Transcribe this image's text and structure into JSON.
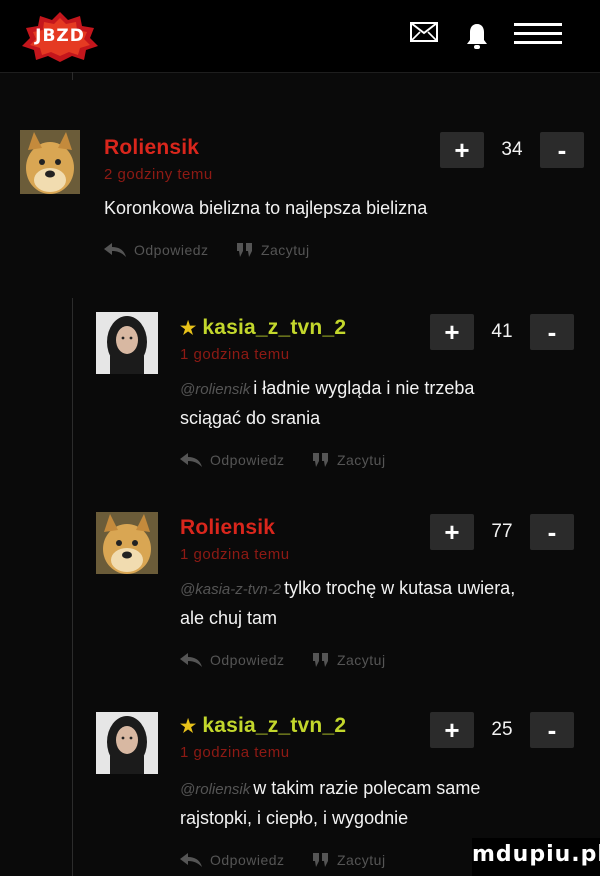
{
  "header": {
    "logo_text": "JBZD",
    "icons": [
      "mail-icon",
      "bell-icon",
      "menu-icon"
    ]
  },
  "actions": {
    "reply_label": "Odpowiedz",
    "quote_label": "Zacytuj"
  },
  "comments": [
    {
      "username": "Roliensik",
      "username_color": "#d9261c",
      "starred": false,
      "time": "2 godziny temu",
      "mention": "",
      "text_lines": [
        "Koronkowa bielizna to najlepsza bielizna"
      ],
      "score": "34",
      "avatar": "doge-avatar"
    },
    {
      "username": "kasia_z_tvn_2",
      "username_color": "#c3d72c",
      "starred": true,
      "time": "1 godzina temu",
      "mention": "@roliensik",
      "text_lines": [
        "i ładnie wygląda i nie trzeba",
        "sciągać do srania"
      ],
      "score": "41",
      "avatar": "woman-avatar"
    },
    {
      "username": "Roliensik",
      "username_color": "#d9261c",
      "starred": false,
      "time": "1 godzina temu",
      "mention": "@kasia-z-tvn-2",
      "text_lines": [
        "tylko trochę w kutasa uwiera,",
        "ale chuj tam"
      ],
      "score": "77",
      "avatar": "doge-avatar"
    },
    {
      "username": "kasia_z_tvn_2",
      "username_color": "#c3d72c",
      "starred": true,
      "time": "1 godzina temu",
      "mention": "@roliensik",
      "text_lines": [
        "w takim razie polecam same",
        "rajstopki, i ciepło, i wygodnie"
      ],
      "score": "25",
      "avatar": "woman-avatar"
    }
  ],
  "vote": {
    "plus": "+",
    "minus": "-"
  },
  "watermark": "mdupiu.pl"
}
